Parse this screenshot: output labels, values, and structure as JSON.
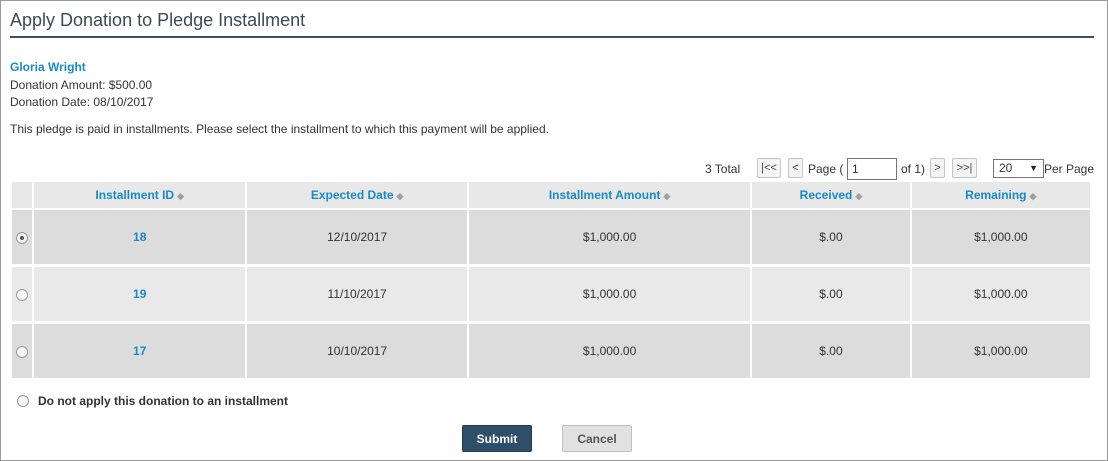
{
  "page": {
    "title": "Apply Donation to Pledge Installment"
  },
  "donor": {
    "name": "Gloria Wright",
    "amount_line": "Donation Amount: $500.00",
    "date_line": "Donation Date: 08/10/2017"
  },
  "instructions": "This pledge is paid in installments. Please select the installment to which this payment will be applied.",
  "pager": {
    "total": "3 Total",
    "first": "|<<",
    "prev": "<",
    "page_label": "Page (",
    "page_value": "1",
    "of_label": "of 1)",
    "next": ">",
    "last": ">>|",
    "per_page_value": "20",
    "per_page_label": "Per Page"
  },
  "table": {
    "columns": [
      "Installment ID",
      "Expected Date",
      "Installment Amount",
      "Received",
      "Remaining"
    ],
    "rows": [
      {
        "id": "18",
        "expected_date": "12/10/2017",
        "amount": "$1,000.00",
        "received": "$.00",
        "remaining": "$1,000.00",
        "selected": true
      },
      {
        "id": "19",
        "expected_date": "11/10/2017",
        "amount": "$1,000.00",
        "received": "$.00",
        "remaining": "$1,000.00",
        "selected": false
      },
      {
        "id": "17",
        "expected_date": "10/10/2017",
        "amount": "$1,000.00",
        "received": "$.00",
        "remaining": "$1,000.00",
        "selected": false
      }
    ]
  },
  "no_apply_label": "Do not apply this donation to an installment",
  "buttons": {
    "submit": "Submit",
    "cancel": "Cancel"
  },
  "colors": {
    "accent": "#1a8ac6",
    "header_rule": "#37536a",
    "submit_bg": "#2f4e69"
  },
  "icons": {
    "sort": "sort-arrows-icon",
    "dropdown": "chevron-down-icon",
    "radio": "radio-button-icon"
  }
}
